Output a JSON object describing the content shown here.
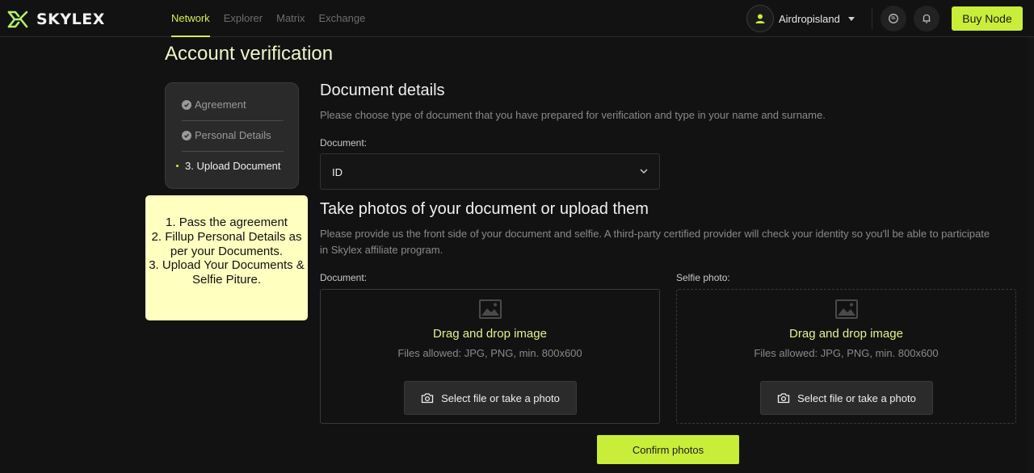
{
  "brand": {
    "name": "SKYLEX",
    "accent": "#c8ee3a"
  },
  "nav": {
    "items": [
      {
        "label": "Network",
        "active": true
      },
      {
        "label": "Explorer",
        "active": false
      },
      {
        "label": "Matrix",
        "active": false
      },
      {
        "label": "Exchange",
        "active": false
      }
    ]
  },
  "header": {
    "username": "Airdropisland",
    "buy_label": "Buy Node",
    "icons": [
      "user-icon",
      "chat-icon",
      "bell-icon",
      "chevron-down-icon"
    ]
  },
  "page": {
    "title": "Account verification"
  },
  "steps": {
    "items": [
      {
        "label": "Agreement",
        "status": "done"
      },
      {
        "label": "Personal Details",
        "status": "done"
      },
      {
        "label": "3. Upload Document",
        "status": "current"
      }
    ]
  },
  "note": {
    "text": "1. Pass the agreement\n2. Fillup Personal Details as per your Documents.\n3. Upload Your Documents & Selfie Piture."
  },
  "document_details": {
    "title": "Document details",
    "description": "Please choose type of document that you have prepared for verification and type in your name and surname.",
    "document_label": "Document:",
    "document_value": "ID"
  },
  "photos": {
    "title": "Take photos of your document or upload them",
    "description": "Please provide us the front side of your document and selfie. A third-party certified provider will check your identity so you'll be able to participate in Skylex affiliate program.",
    "document_label": "Document:",
    "selfie_label": "Selfie photo:",
    "drop_title": "Drag and drop image",
    "drop_sub": "Files allowed: JPG, PNG, min. 800x600",
    "select_label": "Select file or take a photo",
    "confirm_label": "Confirm photos"
  }
}
